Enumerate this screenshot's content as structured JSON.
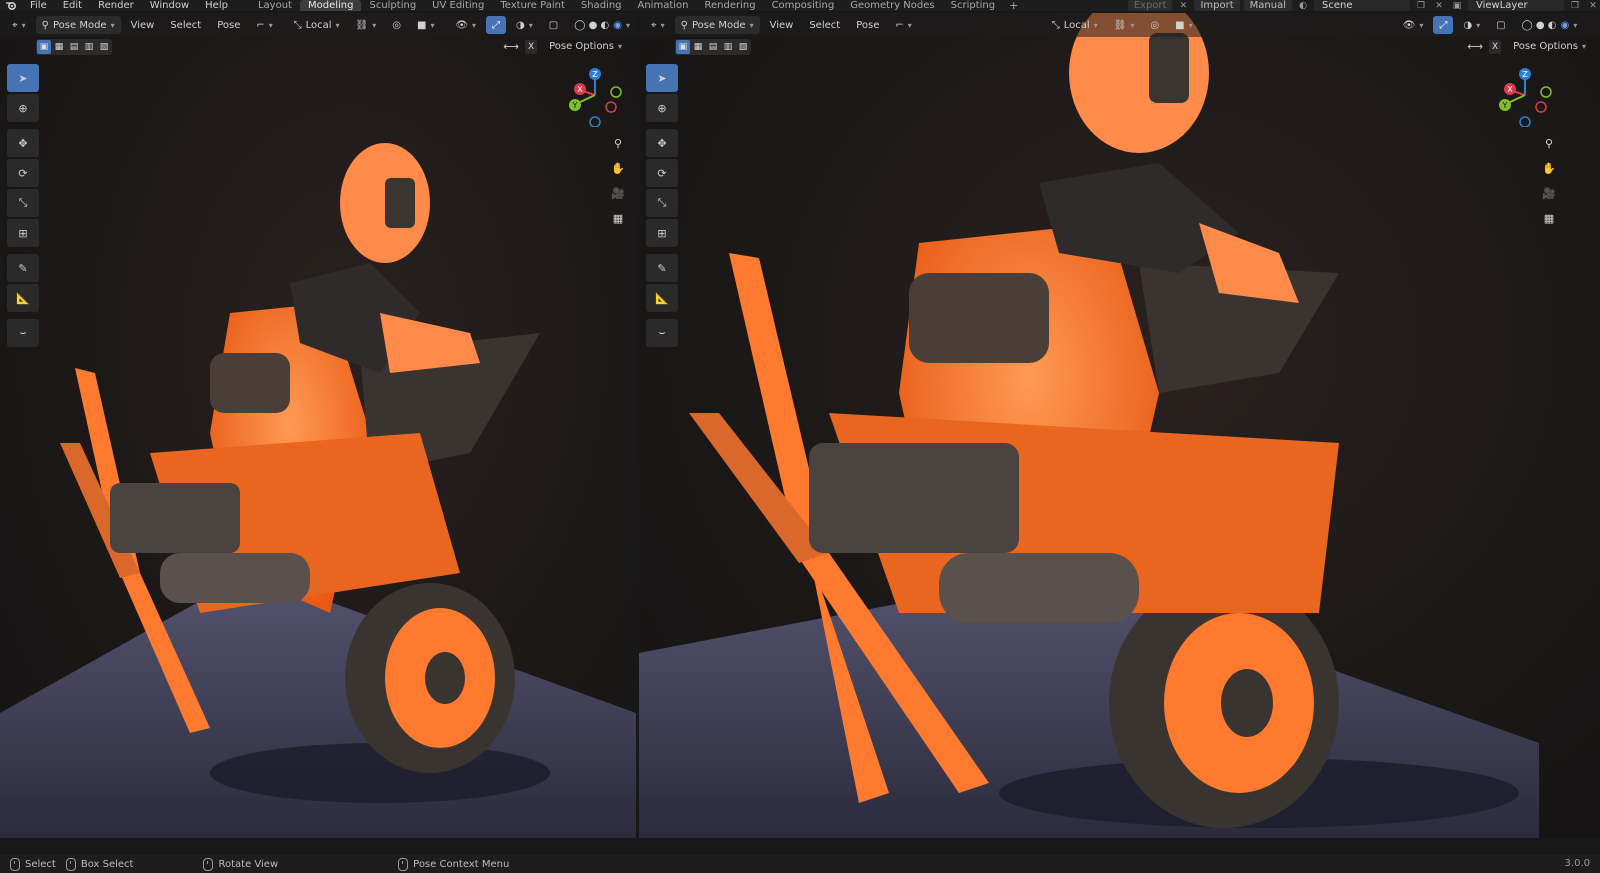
{
  "menu": [
    "File",
    "Edit",
    "Render",
    "Window",
    "Help"
  ],
  "workspaces": [
    {
      "label": "Layout",
      "active": false
    },
    {
      "label": "Modeling",
      "active": true
    },
    {
      "label": "Sculpting",
      "active": false
    },
    {
      "label": "UV Editing",
      "active": false
    },
    {
      "label": "Texture Paint",
      "active": false
    },
    {
      "label": "Shading",
      "active": false
    },
    {
      "label": "Animation",
      "active": false
    },
    {
      "label": "Rendering",
      "active": false
    },
    {
      "label": "Compositing",
      "active": false
    },
    {
      "label": "Geometry Nodes",
      "active": false
    },
    {
      "label": "Scripting",
      "active": false
    }
  ],
  "topbar": {
    "export_label": "Export",
    "import_label": "Import",
    "manual_label": "Manual",
    "scene_value": "Scene",
    "view_layer_value": "ViewLayer",
    "add_workspace": "+"
  },
  "viewports": [
    {
      "mode": "Pose Mode",
      "menus": [
        "View",
        "Select",
        "Pose"
      ],
      "orientation": "Local",
      "pose_options_label": "Pose Options",
      "x_label": "X"
    },
    {
      "mode": "Pose Mode",
      "menus": [
        "View",
        "Select",
        "Pose"
      ],
      "orientation": "Local",
      "pose_options_label": "Pose Options",
      "x_label": "X"
    }
  ],
  "gizmo": {
    "x": "X",
    "y": "Y",
    "z": "Z"
  },
  "statusbar": {
    "select": "Select",
    "box_select": "Box Select",
    "rotate_view": "Rotate View",
    "context_menu": "Pose Context Menu",
    "version": "3.0.0"
  },
  "colors": {
    "accent": "#4772b3",
    "orange": "#ff7a2e",
    "floor": "#4b4a66",
    "axis_x": "#d83b4a",
    "axis_y": "#7fbf2a",
    "axis_z": "#2f7fd6"
  }
}
